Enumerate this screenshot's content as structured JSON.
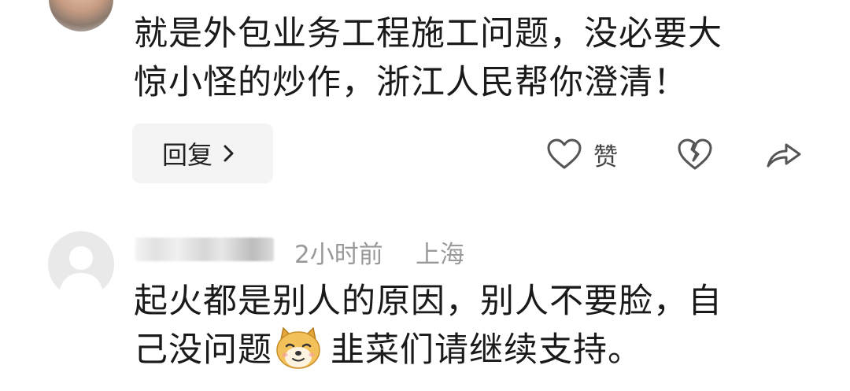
{
  "comment1": {
    "line1": "就是外包业务工程施工问题，没必要大",
    "line2": "惊小怪的炒作，浙江人民帮你澄清！",
    "reply_label": "回复",
    "like_label": "赞"
  },
  "comment2": {
    "time": "2小时前",
    "location": "上海",
    "line1": "起火都是别人的原因，别人不要脸，自",
    "line2_before_emoji": "己没问题",
    "line2_after_emoji": "韭菜们请继续支持。",
    "emoji_icon": "doge-emoji"
  },
  "colors": {
    "text": "#1a1a1a",
    "meta": "#9a9a9a",
    "icon": "#555555",
    "reply_bg": "#f4f4f4"
  }
}
